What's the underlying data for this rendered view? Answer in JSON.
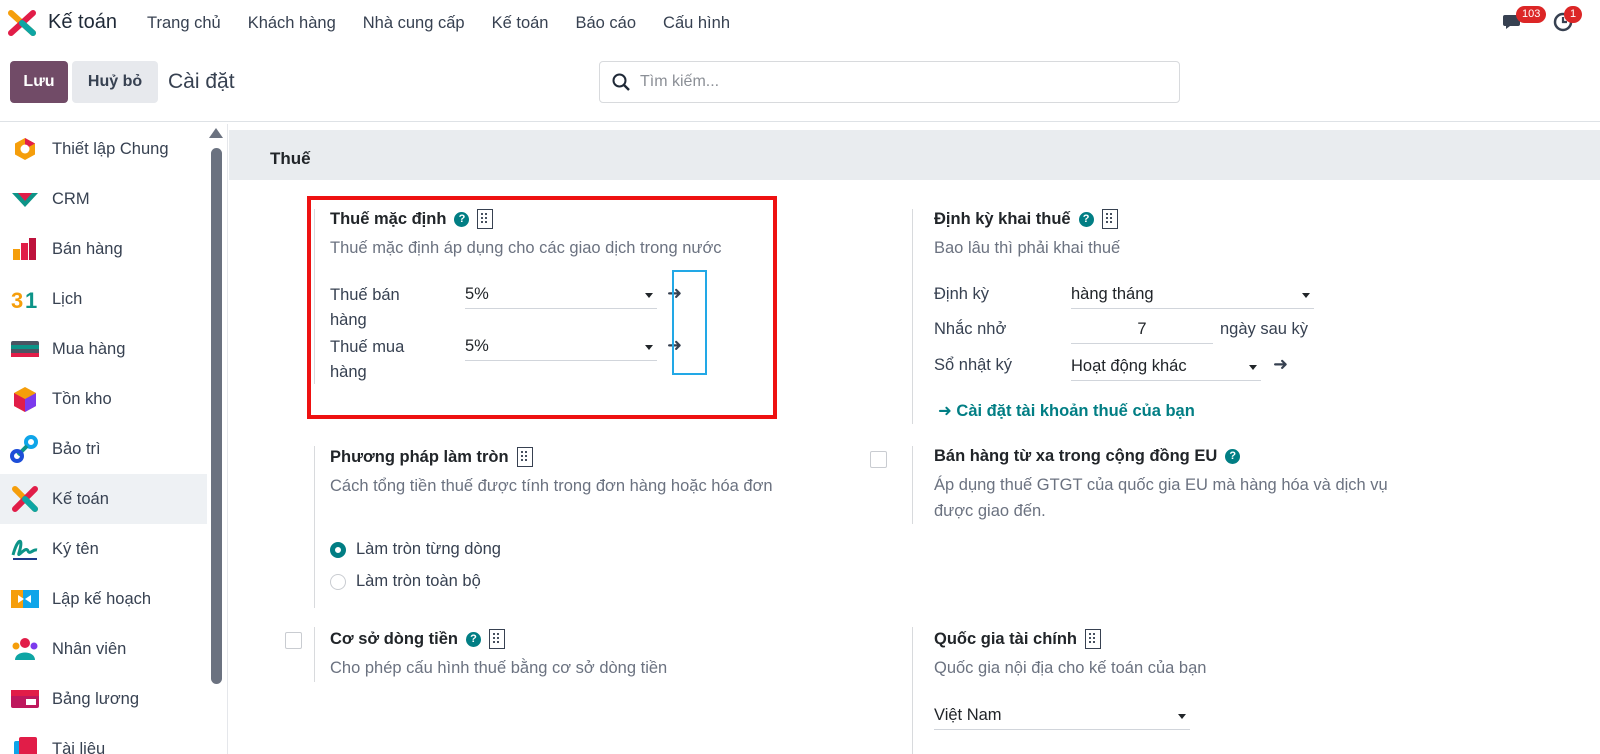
{
  "navbar": {
    "app_name": "Kế toán",
    "menu": [
      "Trang chủ",
      "Khách hàng",
      "Nhà cung cấp",
      "Kế toán",
      "Báo cáo",
      "Cấu hình"
    ],
    "messages_badge": "103",
    "activities_badge": "1"
  },
  "control": {
    "save_label": "Lưu",
    "cancel_label": "Huỷ bỏ",
    "title": "Cài đặt",
    "search_placeholder": "Tìm kiếm..."
  },
  "sidebar": {
    "items": [
      {
        "label": "Thiết lập Chung",
        "icon": "settings-hex-icon"
      },
      {
        "label": "CRM",
        "icon": "crm-icon"
      },
      {
        "label": "Bán hàng",
        "icon": "sales-chart-icon"
      },
      {
        "label": "Lịch",
        "icon": "calendar-31-icon"
      },
      {
        "label": "Mua hàng",
        "icon": "purchase-card-icon"
      },
      {
        "label": "Tồn kho",
        "icon": "inventory-box-icon"
      },
      {
        "label": "Bảo trì",
        "icon": "maintenance-icon"
      },
      {
        "label": "Kế toán",
        "icon": "accounting-icon",
        "active": true
      },
      {
        "label": "Ký tên",
        "icon": "sign-icon"
      },
      {
        "label": "Lập kế hoạch",
        "icon": "planning-icon"
      },
      {
        "label": "Nhân viên",
        "icon": "employees-icon"
      },
      {
        "label": "Bảng lương",
        "icon": "payroll-icon"
      },
      {
        "label": "Tài liệu",
        "icon": "documents-icon"
      }
    ]
  },
  "section": {
    "title": "Thuế"
  },
  "default_taxes": {
    "title": "Thuế mặc định",
    "desc": "Thuế mặc định áp dụng cho các giao dịch trong nước",
    "sales_label_1": "Thuế bán",
    "sales_label_2": "hàng",
    "sales_value": "5%",
    "purchase_label_1": "Thuế mua",
    "purchase_label_2": "hàng",
    "purchase_value": "5%"
  },
  "tax_periodicity": {
    "title": "Định kỳ khai thuế",
    "desc": "Bao lâu thì phải khai thuế",
    "period_label": "Định kỳ",
    "period_value": "hàng tháng",
    "reminder_label": "Nhắc nhở",
    "reminder_value": "7",
    "reminder_suffix": "ngày sau kỳ",
    "journal_label": "Sổ nhật ký",
    "journal_value": "Hoạt động khác",
    "config_link": "Cài đặt tài khoản thuế của bạn"
  },
  "rounding": {
    "title": "Phương pháp làm tròn",
    "desc": "Cách tổng tiền thuế được tính trong đơn hàng hoặc hóa đơn",
    "option_line": "Làm tròn từng dòng",
    "option_global": "Làm tròn toàn bộ",
    "selected": "Làm tròn từng dòng"
  },
  "eu_distance": {
    "title": "Bán hàng từ xa trong cộng đồng EU",
    "desc_1": "Áp dụng thuế GTGT của quốc gia EU mà hàng hóa và dịch vụ",
    "desc_2": "được giao đến."
  },
  "cash_basis": {
    "title": "Cơ sở dòng tiền",
    "desc": "Cho phép cấu hình thuế bằng cơ sở dòng tiền"
  },
  "fiscal_country": {
    "title": "Quốc gia tài chính",
    "desc": "Quốc gia nội địa cho kế toán của bạn",
    "value": "Việt Nam"
  },
  "colors": {
    "brand": "#714b67",
    "teal": "#017e84",
    "highlight_red": "#ee1111",
    "highlight_blue": "#22a8e6"
  }
}
